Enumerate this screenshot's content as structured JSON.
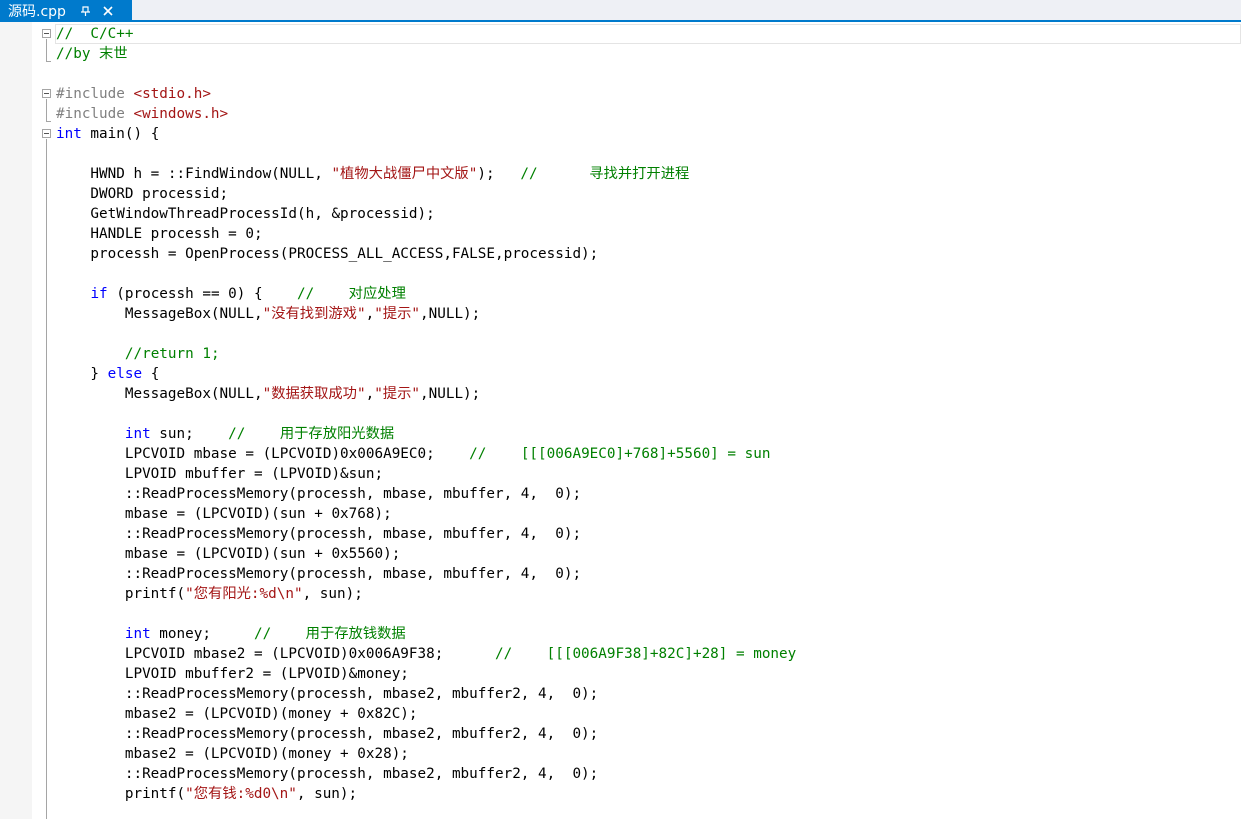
{
  "tab": {
    "title": "源码.cpp",
    "pin_icon": "pin-icon",
    "close_icon": "close-icon"
  },
  "colors": {
    "accent": "#007acc",
    "keyword": "#0000ff",
    "string": "#a31515",
    "comment": "#008000",
    "preprocessor": "#808080",
    "text": "#000000"
  },
  "code_lines": [
    [
      {
        "t": "cm",
        "v": "//  C/C++"
      }
    ],
    [
      {
        "t": "cm",
        "v": "//by 末世"
      }
    ],
    [],
    [
      {
        "t": "pre",
        "v": "#include "
      },
      {
        "t": "str",
        "v": "<stdio.h>"
      }
    ],
    [
      {
        "t": "pre",
        "v": "#include "
      },
      {
        "t": "str",
        "v": "<windows.h>"
      }
    ],
    [
      {
        "t": "kw",
        "v": "int"
      },
      {
        "t": "plain",
        "v": " main() {"
      }
    ],
    [],
    [
      {
        "t": "plain",
        "v": "    HWND h = ::FindWindow(NULL, "
      },
      {
        "t": "str",
        "v": "\"植物大战僵尸中文版\""
      },
      {
        "t": "plain",
        "v": ");   "
      },
      {
        "t": "cm",
        "v": "//      寻找并打开进程"
      }
    ],
    [
      {
        "t": "plain",
        "v": "    DWORD processid;"
      }
    ],
    [
      {
        "t": "plain",
        "v": "    GetWindowThreadProcessId(h, &processid);"
      }
    ],
    [
      {
        "t": "plain",
        "v": "    HANDLE processh = 0;"
      }
    ],
    [
      {
        "t": "plain",
        "v": "    processh = OpenProcess(PROCESS_ALL_ACCESS,FALSE,processid);"
      }
    ],
    [],
    [
      {
        "t": "plain",
        "v": "    "
      },
      {
        "t": "kw",
        "v": "if"
      },
      {
        "t": "plain",
        "v": " (processh == 0) {    "
      },
      {
        "t": "cm",
        "v": "//    对应处理"
      }
    ],
    [
      {
        "t": "plain",
        "v": "        MessageBox(NULL,"
      },
      {
        "t": "str",
        "v": "\"没有找到游戏\""
      },
      {
        "t": "plain",
        "v": ","
      },
      {
        "t": "str",
        "v": "\"提示\""
      },
      {
        "t": "plain",
        "v": ",NULL);"
      }
    ],
    [],
    [
      {
        "t": "plain",
        "v": "        "
      },
      {
        "t": "cm",
        "v": "//return 1;"
      }
    ],
    [
      {
        "t": "plain",
        "v": "    } "
      },
      {
        "t": "kw",
        "v": "else"
      },
      {
        "t": "plain",
        "v": " {"
      }
    ],
    [
      {
        "t": "plain",
        "v": "        MessageBox(NULL,"
      },
      {
        "t": "str",
        "v": "\"数据获取成功\""
      },
      {
        "t": "plain",
        "v": ","
      },
      {
        "t": "str",
        "v": "\"提示\""
      },
      {
        "t": "plain",
        "v": ",NULL);"
      }
    ],
    [],
    [
      {
        "t": "plain",
        "v": "        "
      },
      {
        "t": "kw",
        "v": "int"
      },
      {
        "t": "plain",
        "v": " sun;    "
      },
      {
        "t": "cm",
        "v": "//    用于存放阳光数据"
      }
    ],
    [
      {
        "t": "plain",
        "v": "        LPCVOID mbase = (LPCVOID)0x006A9EC0;    "
      },
      {
        "t": "cm",
        "v": "//    [[[006A9EC0]+768]+5560] = sun"
      }
    ],
    [
      {
        "t": "plain",
        "v": "        LPVOID mbuffer = (LPVOID)&sun;"
      }
    ],
    [
      {
        "t": "plain",
        "v": "        ::ReadProcessMemory(processh, mbase, mbuffer, 4,  0);"
      }
    ],
    [
      {
        "t": "plain",
        "v": "        mbase = (LPCVOID)(sun + 0x768);"
      }
    ],
    [
      {
        "t": "plain",
        "v": "        ::ReadProcessMemory(processh, mbase, mbuffer, 4,  0);"
      }
    ],
    [
      {
        "t": "plain",
        "v": "        mbase = (LPCVOID)(sun + 0x5560);"
      }
    ],
    [
      {
        "t": "plain",
        "v": "        ::ReadProcessMemory(processh, mbase, mbuffer, 4,  0);"
      }
    ],
    [
      {
        "t": "plain",
        "v": "        printf("
      },
      {
        "t": "str",
        "v": "\"您有阳光:%d\\n\""
      },
      {
        "t": "plain",
        "v": ", sun);"
      }
    ],
    [],
    [
      {
        "t": "plain",
        "v": "        "
      },
      {
        "t": "kw",
        "v": "int"
      },
      {
        "t": "plain",
        "v": " money;     "
      },
      {
        "t": "cm",
        "v": "//    用于存放钱数据"
      }
    ],
    [
      {
        "t": "plain",
        "v": "        LPCVOID mbase2 = (LPCVOID)0x006A9F38;      "
      },
      {
        "t": "cm",
        "v": "//    [[[006A9F38]+82C]+28] = money"
      }
    ],
    [
      {
        "t": "plain",
        "v": "        LPVOID mbuffer2 = (LPVOID)&money;"
      }
    ],
    [
      {
        "t": "plain",
        "v": "        ::ReadProcessMemory(processh, mbase2, mbuffer2, 4,  0);"
      }
    ],
    [
      {
        "t": "plain",
        "v": "        mbase2 = (LPCVOID)(money + 0x82C);"
      }
    ],
    [
      {
        "t": "plain",
        "v": "        ::ReadProcessMemory(processh, mbase2, mbuffer2, 4,  0);"
      }
    ],
    [
      {
        "t": "plain",
        "v": "        mbase2 = (LPCVOID)(money + 0x28);"
      }
    ],
    [
      {
        "t": "plain",
        "v": "        ::ReadProcessMemory(processh, mbase2, mbuffer2, 4,  0);"
      }
    ],
    [
      {
        "t": "plain",
        "v": "        printf("
      },
      {
        "t": "str",
        "v": "\"您有钱:%d0\\n\""
      },
      {
        "t": "plain",
        "v": ", sun);"
      }
    ]
  ]
}
